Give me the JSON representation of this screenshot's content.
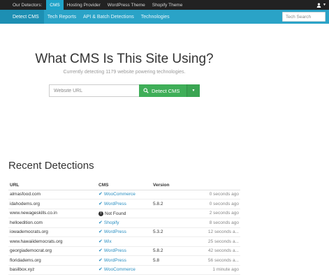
{
  "topnav": {
    "label": "Our Detectors:",
    "items": [
      "CMS",
      "Hosting Provider",
      "WordPress Theme",
      "Shopify Theme"
    ]
  },
  "subnav": {
    "tabs": [
      "Detect CMS",
      "Tech Reports",
      "API & Batch Detections",
      "Technologies"
    ],
    "search_placeholder": "Tech Search"
  },
  "hero": {
    "title": "What CMS Is This Site Using?",
    "subtitle": "Currently detecting 1179 website powering technologies.",
    "input_placeholder": "Website URL",
    "button_label": "Detect CMS"
  },
  "recent": {
    "title": "Recent Detections",
    "columns": [
      "URL",
      "CMS",
      "Version",
      ""
    ],
    "rows": [
      {
        "url": "almasfood.com",
        "cms": "WooCommerce",
        "version": "",
        "time": "0 seconds ago"
      },
      {
        "url": "idahodems.org",
        "cms": "WordPress",
        "version": "5.8.2",
        "time": "0 seconds ago"
      },
      {
        "url": "www.newageskills.co.in",
        "cms": "Not Found",
        "version": "",
        "time": "2 seconds ago"
      },
      {
        "url": "helloedition.com",
        "cms": "Shopify",
        "version": "",
        "time": "8 seconds ago"
      },
      {
        "url": "iowademocrats.org",
        "cms": "WordPress",
        "version": "5.3.2",
        "time": "12 seconds a..."
      },
      {
        "url": "www.hawaiidemocrats.org",
        "cms": "Wix",
        "version": "",
        "time": "25 seconds a..."
      },
      {
        "url": "georgiademocrat.org",
        "cms": "WordPress",
        "version": "5.8.2",
        "time": "42 seconds a..."
      },
      {
        "url": "floridadems.org",
        "cms": "WordPress",
        "version": "5.8",
        "time": "56 seconds a..."
      },
      {
        "url": "basilbox.xyz",
        "cms": "WooCommerce",
        "version": "",
        "time": "1 minute ago"
      }
    ]
  },
  "colors": {
    "accent": "#2aa3c7",
    "button": "#3fae58",
    "link": "#2a8fc2",
    "topbar": "#222222"
  }
}
